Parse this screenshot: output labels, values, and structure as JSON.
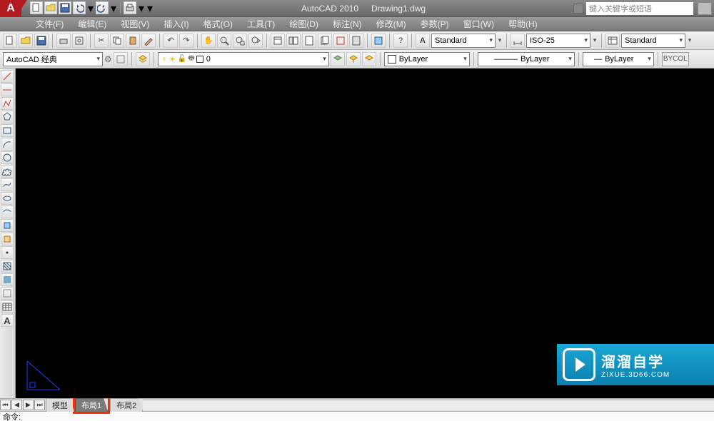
{
  "title": {
    "app": "AutoCAD 2010",
    "doc": "Drawing1.dwg",
    "logo_letter": "A"
  },
  "search": {
    "placeholder": "键入关键字或短语"
  },
  "menu": [
    "文件(F)",
    "编辑(E)",
    "视图(V)",
    "插入(I)",
    "格式(O)",
    "工具(T)",
    "绘图(D)",
    "标注(N)",
    "修改(M)",
    "参数(P)",
    "窗口(W)",
    "帮助(H)"
  ],
  "row1": {
    "workspace": "AutoCAD 经典",
    "layer_value": "0",
    "style1": "Standard",
    "style2": "ISO-25",
    "style3": "Standard"
  },
  "row2": {
    "bylayer_dd": "ByLayer",
    "linetype": "ByLayer",
    "lineweight": "ByLayer",
    "bycolor": "BYCOL"
  },
  "tabs": {
    "model": "模型",
    "layout1": "布局1",
    "layout2": "布局2"
  },
  "cmd": {
    "prompt": "命令:"
  },
  "badge": {
    "cn": "溜溜自学",
    "en": "ZIXUE.3D66.COM"
  }
}
